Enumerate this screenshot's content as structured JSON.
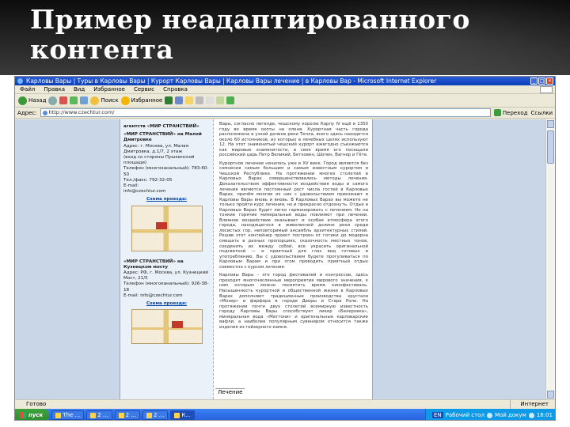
{
  "slide": {
    "title": "Пример неадаптированного контента"
  },
  "browser": {
    "window_title": "Карловы Вары | Туры в Карловы Вары | Курорт Карловы Вары | Карловы Вары лечение | в Карловы Вар - Microsoft Internet Explorer",
    "menu": [
      "Файл",
      "Правка",
      "Вид",
      "Избранное",
      "Сервис",
      "Справка"
    ],
    "toolbar": {
      "back": "Назад",
      "search": "Поиск",
      "favorites": "Избранное"
    },
    "address_label": "Адрес:",
    "address_value": "http://www.czechtur.com/",
    "go_label": "Переход",
    "links_label": "Ссылки"
  },
  "page": {
    "left_column": [
      {
        "type": "heading",
        "text": "агентств «МИР СТРАНСТВИЙ»"
      },
      {
        "type": "heading",
        "text": "«МИР СТРАНСТВИЙ» на Малой Дмитровке"
      },
      {
        "type": "text",
        "text": "Адрес: г. Москва, ул. Малая Дмитровка, д.1/7, 2 этаж"
      },
      {
        "type": "text",
        "text": "(вход со стороны Пушкинской площади)"
      },
      {
        "type": "text",
        "text": "Телефон (многоканальный): 783-60-50"
      },
      {
        "type": "text",
        "text": "Тел./факс: 792-32-05"
      },
      {
        "type": "text",
        "text": "E-mail:"
      },
      {
        "type": "text",
        "text": "info@czechtur.com"
      },
      {
        "type": "link",
        "text": "Схема проезда:"
      },
      {
        "type": "map"
      },
      {
        "type": "heading",
        "text": "«МИР СТРАНСТВИЙ» на Кузнецком мосту"
      },
      {
        "type": "text",
        "text": "Адрес: РФ, г. Москва, ул. Кузнецкий Мост, 21/5"
      },
      {
        "type": "text",
        "text": "Телефон (многоканальный): 926-38-18"
      },
      {
        "type": "text",
        "text": "E-mail: info@czechtur.com"
      },
      {
        "type": "link",
        "text": "Схема проезда:"
      },
      {
        "type": "map2"
      }
    ],
    "right_paragraphs": [
      "Вары, согласно легенде, чешскому королю Карлу IV ещё в 1350 году во время охоты на оленя. Курортная часть города расположена в узкой долине реки Тепла, всего здесь находится около 60 источников, из которых в лечебных целях используют 12. На этот знаменитый чешский курорт ежегодно съезжаются как мировые знаменитости, в свое время его посещали российский царь Петр Великий, Бетховен, Шопен, Вагнер и Гёте.",
      "Курортное лечение началось уже в XV веке. Город является без сомнения самым большим и самым известным курортом в Чешской Республике. На протяжении многих столетий в Карловых Варах совершенствовались методы лечения. Доказательством эффективности воздействия воды и самого лечения является постоянный рост числа гостей в Карловых Варах, причём многие из них с удовольствием приезжают в Карловы Вары вновь и вновь. В Карловых Варах вы можете не только пройти курс лечения, но и прекрасно отдохнуть. Отдых в Карловых Варах будет легко гармонировать с лечением. Но на тонкие горячие минеральные воды повлияют при лечении. Влияние воздействие оказывает и особая атмосфера этого города, находящегося в живописной долине реки среди лесистых гор, неповторимый ансамбль архитектурных стилей. Решив этот контейнер проект построен от готики до модерна смешать в разных пропорциях, сказочность местных тонов, соединить их между собой, все украсить оригинальной подсветкой — и приятный для глаз вид готовых в употреблению. Вы с удовольствием будете прогуливаться по Карловым Варам и при этом проводить приятный отдых совместно с курсом лечения.",
      "Карловы Вары – это город фестивалей и конгрессов, здесь проходят многочисленные мероприятия мирового значения, к ним которым можно посвятить время кинофестиваль. Насыщенность курортной и общественной жизни в Карловых Варах дополняют традиционные производства хрусталя «Мозер» и фарфора в городе Дворы и Стара Роле. На протяжении почти двух столетий всемирную известность городу Карловы Вары способствует ликер «Бехеровка», минеральная вода «Маттони» и оригинальные карловарские вафли, а наиболее популярным сувениром относится также изделия из гейзерного камня."
    ],
    "bottom_heading": "Лечение"
  },
  "status": {
    "left": "Готово",
    "zone": "Интернет"
  },
  "taskbar": {
    "start": "пуск",
    "buttons": [
      "The ...",
      "2 ...",
      "2 ...",
      "2 ...",
      "К..."
    ],
    "lang": "EN",
    "desktop": "Рабочий стол",
    "my_computer": "Мой докум",
    "clock": "18:01"
  }
}
